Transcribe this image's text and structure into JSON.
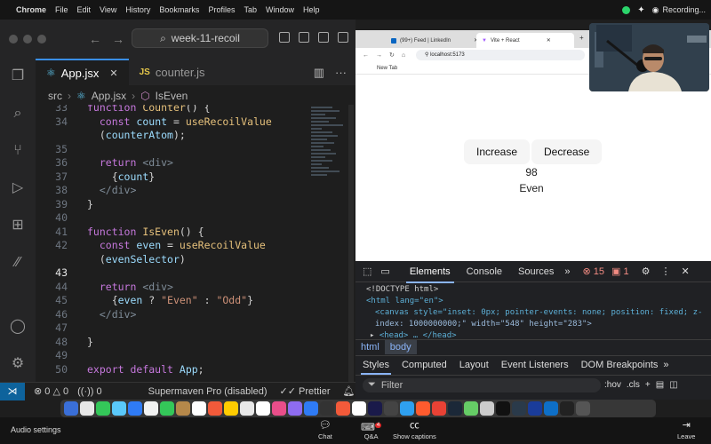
{
  "menubar": {
    "items": [
      "Chrome",
      "File",
      "Edit",
      "View",
      "History",
      "Bookmarks",
      "Profiles",
      "Tab",
      "Window",
      "Help"
    ],
    "recording": "Recording..."
  },
  "vscode": {
    "search": "week-11-recoil",
    "tabs": [
      {
        "label": "App.jsx",
        "active": true
      },
      {
        "label": "counter.js",
        "active": false
      }
    ],
    "breadcrumb": [
      "src",
      "App.jsx",
      "IsEven"
    ],
    "lines": [
      {
        "n": "33",
        "text": "function Counter() {"
      },
      {
        "n": "34",
        "text": "  const count = useRecoilValue"
      },
      {
        "n": "",
        "text": "  (counterAtom);"
      },
      {
        "n": "35",
        "text": ""
      },
      {
        "n": "36",
        "text": "  return <div>"
      },
      {
        "n": "37",
        "text": "    {count}"
      },
      {
        "n": "38",
        "text": "  </div>"
      },
      {
        "n": "39",
        "text": "}"
      },
      {
        "n": "40",
        "text": ""
      },
      {
        "n": "41",
        "text": "function IsEven() {"
      },
      {
        "n": "42",
        "text": "  const even = useRecoilValue"
      },
      {
        "n": "",
        "text": "  (evenSelector)"
      },
      {
        "n": "43",
        "text": ""
      },
      {
        "n": "44",
        "text": "  return <div>"
      },
      {
        "n": "45",
        "text": "    {even ? \"Even\" : \"Odd\"}"
      },
      {
        "n": "46",
        "text": "  </div>"
      },
      {
        "n": "47",
        "text": ""
      },
      {
        "n": "48",
        "text": "}"
      },
      {
        "n": "49",
        "text": ""
      },
      {
        "n": "50",
        "text": "export default App;"
      }
    ],
    "status": {
      "errors": "0",
      "warnings": "0",
      "ports": "0",
      "supermaven": "Supermaven Pro (disabled)",
      "prettier": "Prettier"
    }
  },
  "browser": {
    "tabs": [
      "(99+) Feed | LinkedIn",
      "Vite + React"
    ],
    "url": "localhost:5173",
    "bookmark": "New Tab",
    "increase_label": "Increase",
    "decrease_label": "Decrease",
    "count": "98",
    "parity": "Even"
  },
  "devtools": {
    "tabs": [
      "Elements",
      "Console",
      "Sources"
    ],
    "errors": "15",
    "warnings": "1",
    "source_lines": [
      "<!DOCTYPE html>",
      "<html lang=\"en\">",
      "<canvas style=\"inset: 0px; pointer-events: none; position: fixed; z-",
      "index: 1000000000;\" width=\"548\" height=\"283\">",
      "<head> … </head>"
    ],
    "crumbs": [
      "html",
      "body"
    ],
    "subtabs": [
      "Styles",
      "Computed",
      "Layout",
      "Event Listeners",
      "DOM Breakpoints"
    ],
    "filter_placeholder": "Filter",
    "filter_tools": [
      ":hov",
      ".cls",
      "+"
    ]
  },
  "meeting": {
    "audio_settings": "Audio settings",
    "chat": "Chat",
    "qa": "Q&A",
    "qa_badge": "4",
    "captions": "Show captions",
    "leave": "Leave"
  },
  "dock_colors": [
    "#3a6fd8",
    "#e8e8e8",
    "#34c759",
    "#5ac8fa",
    "#2f7bf5",
    "#f2f2f2",
    "#34c759",
    "#b5884a",
    "#ffffff",
    "#f25a3a",
    "#ffcc00",
    "#e8e8e8",
    "#ffffff",
    "#e94e8a",
    "#8e6cf0",
    "#2f7bf5",
    "#333333",
    "#f25a3a",
    "#ffffff",
    "#1a1a4a",
    "#444444",
    "#2fa0f0",
    "#ff5b2e",
    "#e94235",
    "#1b2838",
    "#66cc66",
    "#cccccc",
    "#111111",
    "#2a3a4a",
    "#1a3c9a",
    "#0e6fc7",
    "#222222",
    "#555555"
  ]
}
